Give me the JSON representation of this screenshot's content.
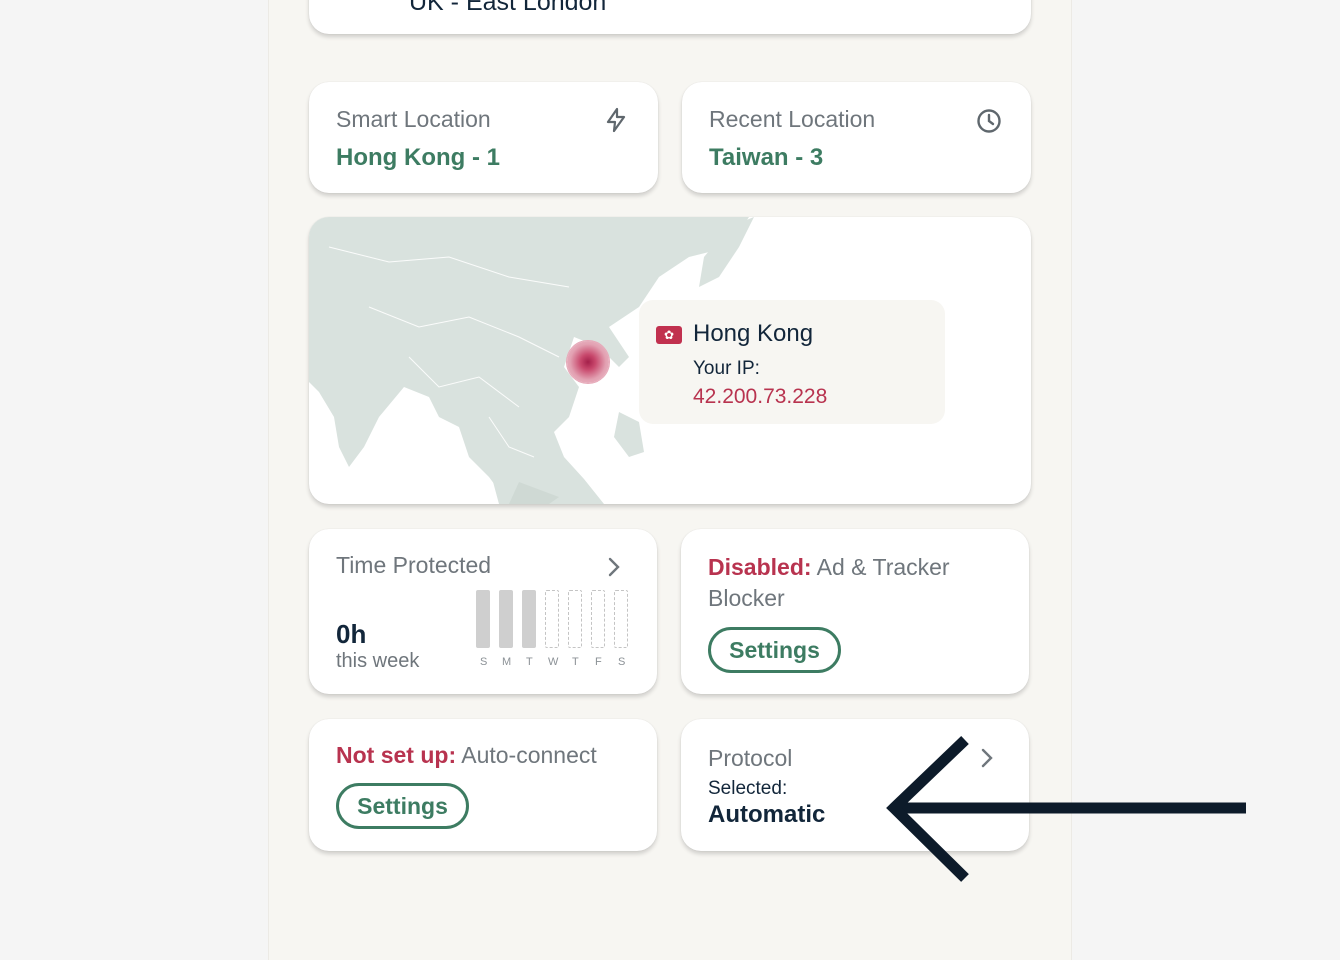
{
  "top_card": {
    "location": "UK - East London"
  },
  "smart_location": {
    "title": "Smart Location",
    "value": "Hong Kong - 1",
    "icon": "lightning-icon"
  },
  "recent_location": {
    "title": "Recent Location",
    "value": "Taiwan - 3",
    "icon": "clock-icon"
  },
  "map": {
    "country": "Hong Kong",
    "ip_label": "Your IP:",
    "ip": "42.200.73.228",
    "flag_icon": "hong-kong-flag-icon"
  },
  "time_protected": {
    "title": "Time Protected",
    "hours": "0h",
    "period": "this week",
    "days": [
      "S",
      "M",
      "T",
      "W",
      "T",
      "F",
      "S"
    ]
  },
  "blocker": {
    "status": "Disabled:",
    "title": "Ad & Tracker Blocker",
    "button": "Settings"
  },
  "autoconnect": {
    "status": "Not set up:",
    "title": "Auto-connect",
    "button": "Settings"
  },
  "protocol": {
    "title": "Protocol",
    "selected_label": "Selected:",
    "value": "Automatic"
  },
  "colors": {
    "accent_green": "#3d7c62",
    "alert_red": "#b8334f",
    "arrow": "#0d1b2a"
  }
}
